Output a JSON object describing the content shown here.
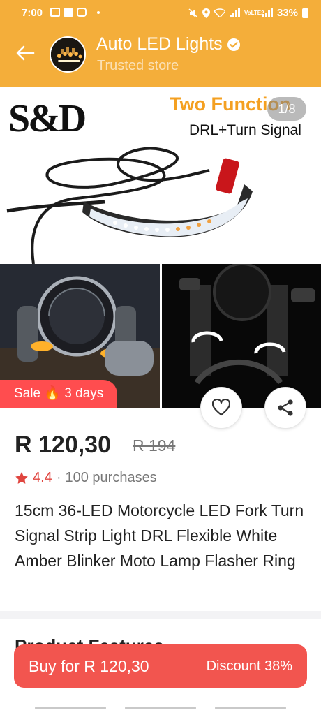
{
  "status_bar": {
    "time": "7:00",
    "battery": "33%",
    "network": "VoLTE2"
  },
  "header": {
    "store_name": "Auto LED Lights",
    "store_subtitle": "Trusted store"
  },
  "gallery": {
    "counter": "1/8",
    "brand_logo": "S&D",
    "headline": "Two Function",
    "subheadline": "DRL+Turn Signal"
  },
  "sale_badge": {
    "label": "Sale",
    "icon": "fire-icon",
    "duration": "3 days"
  },
  "product": {
    "price": "R 120,30",
    "original_price": "R 194",
    "rating": "4.4",
    "purchases": "100 purchases",
    "title": "15cm 36-LED Motorcycle LED Fork Turn Signal Strip Light DRL Flexible White Amber Blinker Moto Lamp Flasher Ring"
  },
  "section": {
    "title": "Product Features"
  },
  "buy_bar": {
    "label": "Buy for R 120,30",
    "discount": "Discount 38%"
  },
  "colors": {
    "brand": "#f4ae3a",
    "sale": "#ff4d4f",
    "buy": "#f2554f",
    "rating": "#e0453f"
  }
}
